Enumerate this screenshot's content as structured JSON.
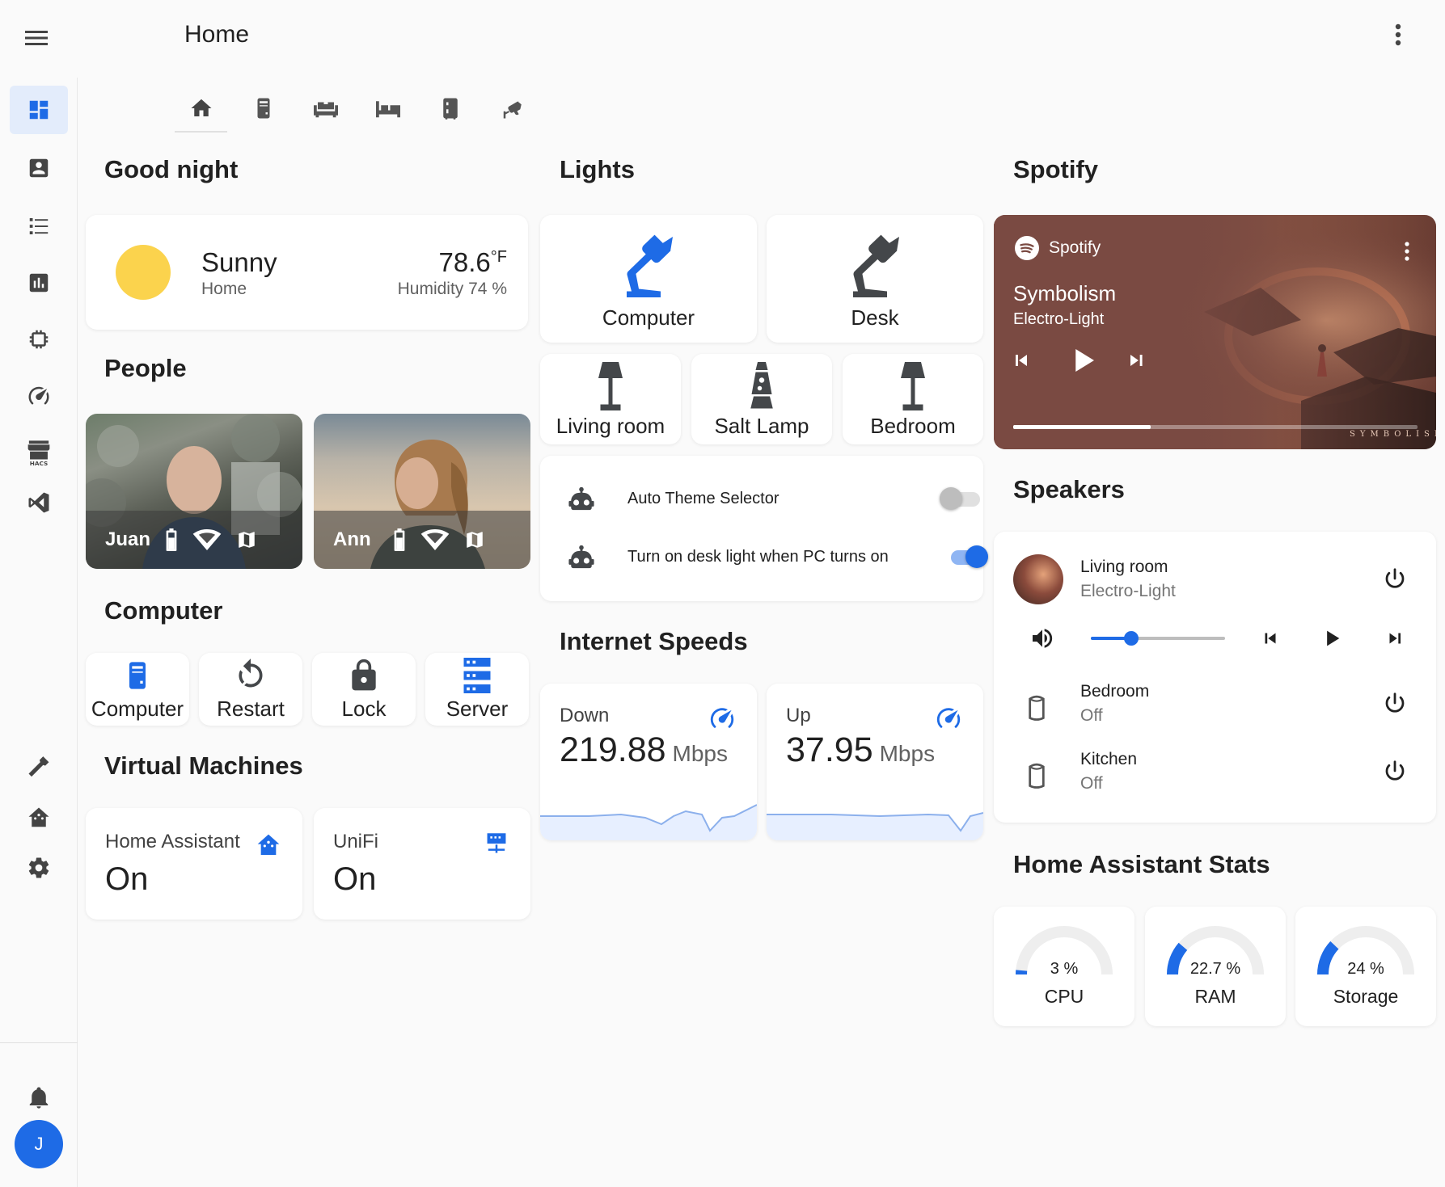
{
  "header": {
    "title": "Home"
  },
  "tabs": [
    {
      "icon": "home-icon"
    },
    {
      "icon": "computer-tower-icon"
    },
    {
      "icon": "sofa-icon"
    },
    {
      "icon": "bed-icon"
    },
    {
      "icon": "fridge-icon"
    },
    {
      "icon": "cctv-icon"
    }
  ],
  "sidebar": {
    "items": [
      {
        "icon": "dashboard-icon",
        "active": true
      },
      {
        "icon": "account-box-icon"
      },
      {
        "icon": "format-list-icon"
      },
      {
        "icon": "chart-box-icon"
      },
      {
        "icon": "memory-chip-icon"
      },
      {
        "icon": "speedometer-icon"
      },
      {
        "icon": "hacs-store-icon",
        "badge": "HACS"
      },
      {
        "icon": "vscode-icon"
      },
      {
        "icon": "hammer-icon"
      },
      {
        "icon": "home-assistant-icon"
      },
      {
        "icon": "cog-icon"
      },
      {
        "icon": "bell-icon"
      }
    ],
    "avatar_initial": "J"
  },
  "columns": {
    "left": {
      "greeting": "Good night",
      "weather": {
        "condition": "Sunny",
        "location": "Home",
        "temp": "78.6",
        "unit": "°F",
        "humidity": "Humidity 74 %"
      },
      "people_heading": "People",
      "people": [
        {
          "name": "Juan"
        },
        {
          "name": "Ann"
        }
      ],
      "computer_heading": "Computer",
      "computer_buttons": [
        {
          "label": "Computer",
          "icon": "computer-tower-icon"
        },
        {
          "label": "Restart",
          "icon": "restart-icon"
        },
        {
          "label": "Lock",
          "icon": "lock-icon"
        },
        {
          "label": "Server",
          "icon": "server-icon"
        }
      ],
      "vm_heading": "Virtual Machines",
      "vms": [
        {
          "name": "Home Assistant",
          "state": "On",
          "icon": "home-assistant-icon"
        },
        {
          "name": "UniFi",
          "state": "On",
          "icon": "server-network-icon"
        }
      ]
    },
    "middle": {
      "lights_heading": "Lights",
      "lamps_large": [
        {
          "label": "Computer",
          "on": true
        },
        {
          "label": "Desk",
          "on": false
        }
      ],
      "lamps_small": [
        {
          "label": "Living room",
          "icon": "floor-lamp-icon"
        },
        {
          "label": "Salt Lamp",
          "icon": "lava-lamp-icon"
        },
        {
          "label": "Bedroom",
          "icon": "floor-lamp-icon"
        }
      ],
      "automations": [
        {
          "label": "Auto Theme Selector",
          "on": false
        },
        {
          "label": "Turn on desk light when PC turns on",
          "on": true
        }
      ],
      "internet_heading": "Internet Speeds",
      "speeds": [
        {
          "title": "Down",
          "value": "219.88",
          "unit": "Mbps"
        },
        {
          "title": "Up",
          "value": "37.95",
          "unit": "Mbps"
        }
      ]
    },
    "right": {
      "spotify_heading": "Spotify",
      "spotify": {
        "brand": "Spotify",
        "song": "Symbolism",
        "artist": "Electro-Light",
        "progress": 0.34,
        "art_text": "SYMBOLISM"
      },
      "speakers_heading": "Speakers",
      "speakers": [
        {
          "name": "Living room",
          "state": "Electro-Light",
          "volume": 0.3
        },
        {
          "name": "Bedroom",
          "state": "Off"
        },
        {
          "name": "Kitchen",
          "state": "Off"
        }
      ],
      "stats_heading": "Home Assistant Stats",
      "stats": [
        {
          "label": "CPU",
          "value": "3 %",
          "pct": 3
        },
        {
          "label": "RAM",
          "value": "22.7 %",
          "pct": 22.7
        },
        {
          "label": "Storage",
          "value": "24 %",
          "pct": 24
        }
      ]
    }
  },
  "colors": {
    "accent": "#1e6be6",
    "lamp_off": "#44474a",
    "weather_sun": "#fbd34d",
    "spotify_bg": "#7a4a42"
  }
}
